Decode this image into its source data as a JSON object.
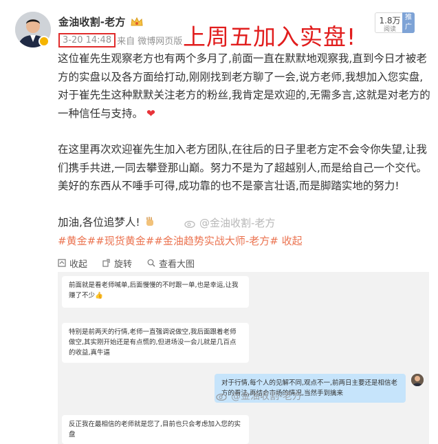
{
  "user": {
    "name": "金油收割-老方",
    "time": "3-20 14:48",
    "source": "来自 微博网页版"
  },
  "annotation": {
    "headline": "上周五加入实盘!"
  },
  "fans": {
    "count": "1.8万",
    "label": "阅读",
    "tag": "推广"
  },
  "post": {
    "p1": "这位崔先生观察老方也有两个多月了,前面一直在默默地观察我,直到今日才被老方的实盘以及各方面给打动,刚刚找到老方聊了一会,说方老师,我想加入您实盘,对于崔先生这种默默关注老方的粉丝,我肯定是欢迎的,无需多言,这就是对老方的一种信任与支持。",
    "heart": "❤",
    "p2": "在这里再次欢迎崔先生加入老方团队,在往后的日子里老方定不会令你失望,让我们携手共进,一同去攀登那山巅。努力不是为了超越别人,而是给自己一个交代。美好的东西从不唾手可得,成功靠的也不是豪言壮语,而是脚踏实地的努力!",
    "p3": "加油,各位追梦人!",
    "hashtags": "#黄金##现货黄金##金油趋势实战大师-老方# 收起"
  },
  "watermarks": {
    "top": "@金油收割-老方",
    "image": "@金油收割-老方"
  },
  "toolbar": {
    "collapse": "收起",
    "rotate": "旋转",
    "view_large": "查看大图"
  },
  "chat": {
    "msg1": "前面就是看老师喊单,后面慢慢的不时跟一单,也是幸运,让我赚了不少👍",
    "msg2": "特别是前两天的行情,老师一直强调说做空,我后面跟着老师做空,其实刚开始还是有点慌的,但进场没一会儿就是几百点的收益,真牛逼",
    "msg3": "对于行情,每个人的见解不同,观点不一,前两日主要还是相信老方的看法,再结合市场的情况,当然手到擒来",
    "msg4": "反正我在最相信的老师就是您了,目前也只会考虑加入您的实盘"
  },
  "colors": {
    "headline": "#e11d1d",
    "hashtag": "#eb7350",
    "time_box": "#e02a2a",
    "bubble_self": "#c6e4fb"
  }
}
